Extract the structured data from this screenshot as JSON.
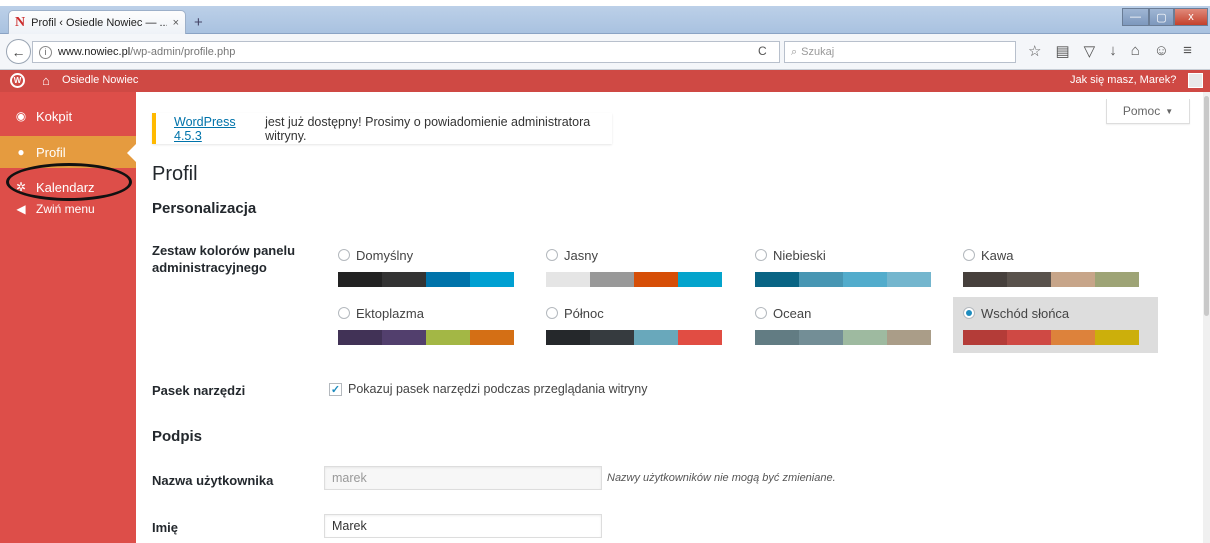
{
  "browser": {
    "tab_title": "Profil ‹ Osiedle Nowiec — ...",
    "tab_close": "×",
    "new_tab": "+",
    "url_domain": "www.nowiec.pl",
    "url_path": "/wp-admin/profile.php",
    "search_placeholder": "Szukaj",
    "window_min": "—",
    "window_max": "▢",
    "window_close": "x"
  },
  "adminbar": {
    "site_name": "Osiedle Nowiec",
    "greeting": "Jak się masz, Marek?"
  },
  "sidebar": {
    "items": [
      {
        "label": "Kokpit",
        "icon": "dashboard-icon"
      },
      {
        "label": "Profil",
        "icon": "user-icon"
      },
      {
        "label": "Kalendarz",
        "icon": "gear-icon"
      },
      {
        "label": "Zwiń menu",
        "icon": "collapse-icon"
      }
    ]
  },
  "help": {
    "label": "Pomoc",
    "arrow": "▼"
  },
  "notice": {
    "link": "WordPress 4.5.3",
    "text": "jest już dostępny! Prosimy o powiadomienie administratora witryny."
  },
  "page": {
    "title": "Profil",
    "section_personal": "Personalizacja",
    "label_scheme": "Zestaw kolorów panelu administracyjnego",
    "label_toolbar": "Pasek narzędzi",
    "toolbar_checkbox": "Pokazuj pasek narzędzi podczas przeglądania witryny",
    "section_name": "Podpis",
    "label_username": "Nazwa użytkownika",
    "username_value": "marek",
    "username_desc": "Nazwy użytkowników nie mogą być zmieniane.",
    "label_firstname": "Imię",
    "firstname_value": "Marek"
  },
  "schemes": [
    {
      "name": "Domyślny",
      "colors": [
        "#222222",
        "#333333",
        "#0073aa",
        "#00a0d2"
      ],
      "selected": false
    },
    {
      "name": "Jasny",
      "colors": [
        "#e5e5e5",
        "#999999",
        "#d64e07",
        "#04a4cc"
      ],
      "selected": false
    },
    {
      "name": "Niebieski",
      "colors": [
        "#096484",
        "#4796b3",
        "#52accc",
        "#74b6ce"
      ],
      "selected": false
    },
    {
      "name": "Kawa",
      "colors": [
        "#46403c",
        "#59524c",
        "#c7a589",
        "#9ea476"
      ],
      "selected": false
    },
    {
      "name": "Ektoplazma",
      "colors": [
        "#413256",
        "#523f6d",
        "#a3b745",
        "#d46f15"
      ],
      "selected": false
    },
    {
      "name": "Północ",
      "colors": [
        "#25282b",
        "#363b3f",
        "#69a8bb",
        "#e14d43"
      ],
      "selected": false
    },
    {
      "name": "Ocean",
      "colors": [
        "#627c83",
        "#738e96",
        "#9ebaa0",
        "#aa9d88"
      ],
      "selected": false
    },
    {
      "name": "Wschód słońca",
      "colors": [
        "#b43c38",
        "#cf4944",
        "#dd823b",
        "#ccaf0b"
      ],
      "selected": true
    }
  ],
  "colors": {
    "admin_red": "#cf4944",
    "sidebar_red": "#dd4e49",
    "active_orange": "#e59b3f"
  }
}
